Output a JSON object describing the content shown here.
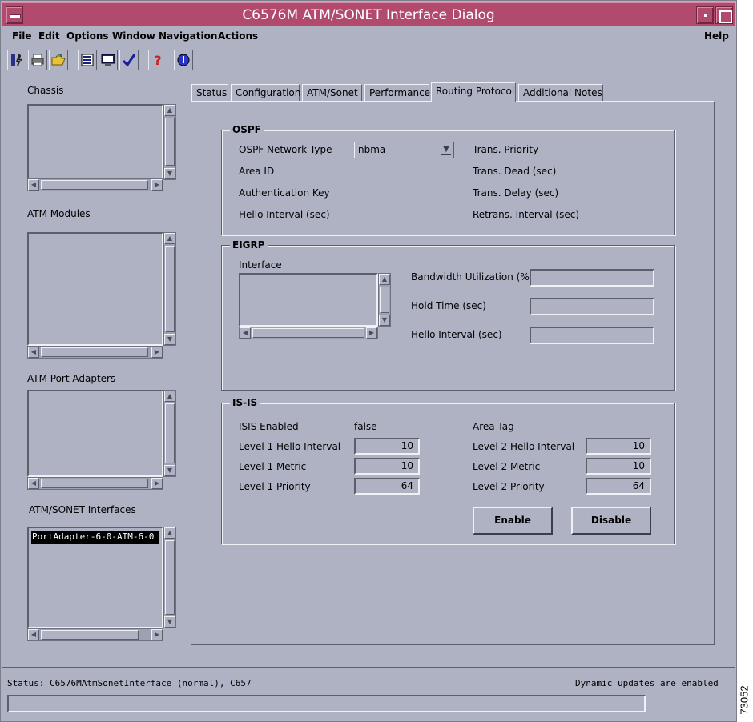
{
  "window": {
    "title": "C6576M ATM/SONET Interface Dialog"
  },
  "menubar": {
    "items": [
      "File",
      "Edit",
      "Options",
      "Window",
      "Navigation",
      "Actions"
    ],
    "help": "Help"
  },
  "toolbar": {
    "icons": [
      "exit-icon",
      "print-icon",
      "open-folder-icon",
      "list-icon",
      "monitor-icon",
      "checkmark-icon",
      "help-icon",
      "info-icon"
    ]
  },
  "sidebar": {
    "chassis_label": "Chassis",
    "atm_modules_label": "ATM Modules",
    "atm_port_adapters_label": "ATM Port Adapters",
    "atm_sonet_interfaces_label": "ATM/SONET Interfaces",
    "selected_interface": "PortAdapter-6-0-ATM-6-0"
  },
  "tabs": [
    "Status",
    "Configuration",
    "ATM/Sonet",
    "Performance",
    "Routing Protocol",
    "Additional Notes"
  ],
  "active_tab": "Routing Protocol",
  "ospf": {
    "title": "OSPF",
    "network_type_label": "OSPF Network Type",
    "network_type_value": "nbma",
    "area_id_label": "Area ID",
    "auth_key_label": "Authentication Key",
    "hello_interval_label": "Hello Interval (sec)",
    "trans_priority_label": "Trans. Priority",
    "trans_dead_label": "Trans. Dead (sec)",
    "trans_delay_label": "Trans. Delay (sec)",
    "retrans_interval_label": "Retrans. Interval (sec)"
  },
  "eigrp": {
    "title": "EIGRP",
    "interface_label": "Interface",
    "bandwidth_label": "Bandwidth Utilization (%)",
    "hold_time_label": "Hold Time (sec)",
    "hello_interval_label": "Hello Interval (sec)",
    "bandwidth_value": "",
    "hold_time_value": "",
    "hello_interval_value": ""
  },
  "isis": {
    "title": "IS-IS",
    "enabled_label": "ISIS Enabled",
    "enabled_value": "false",
    "area_tag_label": "Area Tag",
    "l1_hello_label": "Level 1 Hello Interval",
    "l1_hello_value": "10",
    "l1_metric_label": "Level 1 Metric",
    "l1_metric_value": "10",
    "l1_priority_label": "Level 1 Priority",
    "l1_priority_value": "64",
    "l2_hello_label": "Level 2 Hello Interval",
    "l2_hello_value": "10",
    "l2_metric_label": "Level 2 Metric",
    "l2_metric_value": "10",
    "l2_priority_label": "Level 2 Priority",
    "l2_priority_value": "64",
    "enable_button": "Enable",
    "disable_button": "Disable"
  },
  "statusbar": {
    "status": "Status: C6576MAtmSonetInterface (normal), C657",
    "updates": "Dynamic updates are enabled"
  },
  "figure_id": "73052"
}
